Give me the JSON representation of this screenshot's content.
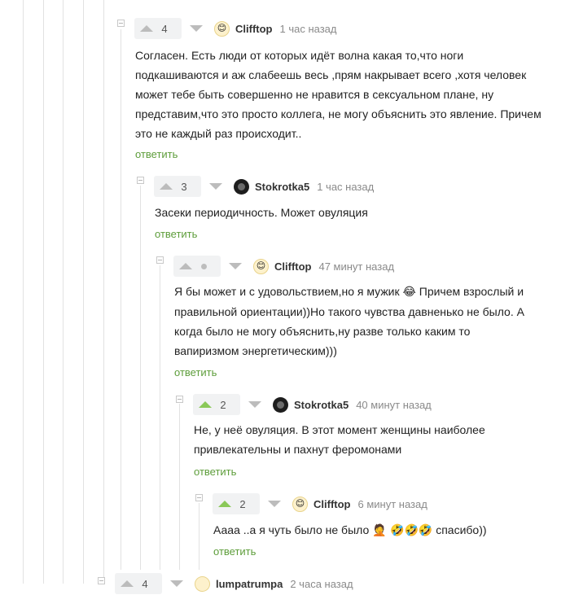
{
  "comments": [
    {
      "rating": "4",
      "author": "Clifftop",
      "time": "1 час назад",
      "text": "Согласен. Есть люди от которых идёт волна какая то,что ноги подкашиваются и аж слабеешь весь ,прям накрывает всего ,хотя человек может тебе быть совершенно не нравится в сексуальном плане, ну представим,что это просто коллега, не могу объяснить это явление. Причем это не каждый раз происходит..",
      "reply": "ответить"
    },
    {
      "rating": "3",
      "author": "Stokrotka5",
      "time": "1 час назад",
      "text": "Засеки периодичность. Может овуляция",
      "reply": "ответить"
    },
    {
      "rating": "",
      "author": "Clifftop",
      "time": "47 минут назад",
      "text": "Я бы может и с удовольствием,но я мужик",
      "emoji": "😂",
      "text_cont": " Причем взрослый и правильной ориентации))Но такого чувства давненько не было. А когда было не могу объяснить,ну разве только каким то вапиризмом энергетическим)))",
      "reply": "ответить"
    },
    {
      "rating": "2",
      "author": "Stokrotka5",
      "time": "40 минут назад",
      "text": "Не, у неё овуляция. В этот момент женщины наиболее привлекательны и пахнут феромонами",
      "reply": "ответить"
    },
    {
      "rating": "2",
      "author": "Clifftop",
      "time": "6 минут назад",
      "text": "Аааа ..а я чуть было не было",
      "emojis": "🤦 🤣🤣🤣",
      "text_cont": " спасибо))",
      "reply": "ответить"
    },
    {
      "rating": "4",
      "author": "lumpatrumpa",
      "time": "2 часа назад"
    }
  ],
  "colors": {
    "upvoted": "#8ac858",
    "reply_link": "#5d9d3a",
    "meta": "#8a8a8a"
  },
  "icons": [
    "arrow-up-icon",
    "arrow-down-icon",
    "avatar-icon",
    "collapse-icon"
  ]
}
